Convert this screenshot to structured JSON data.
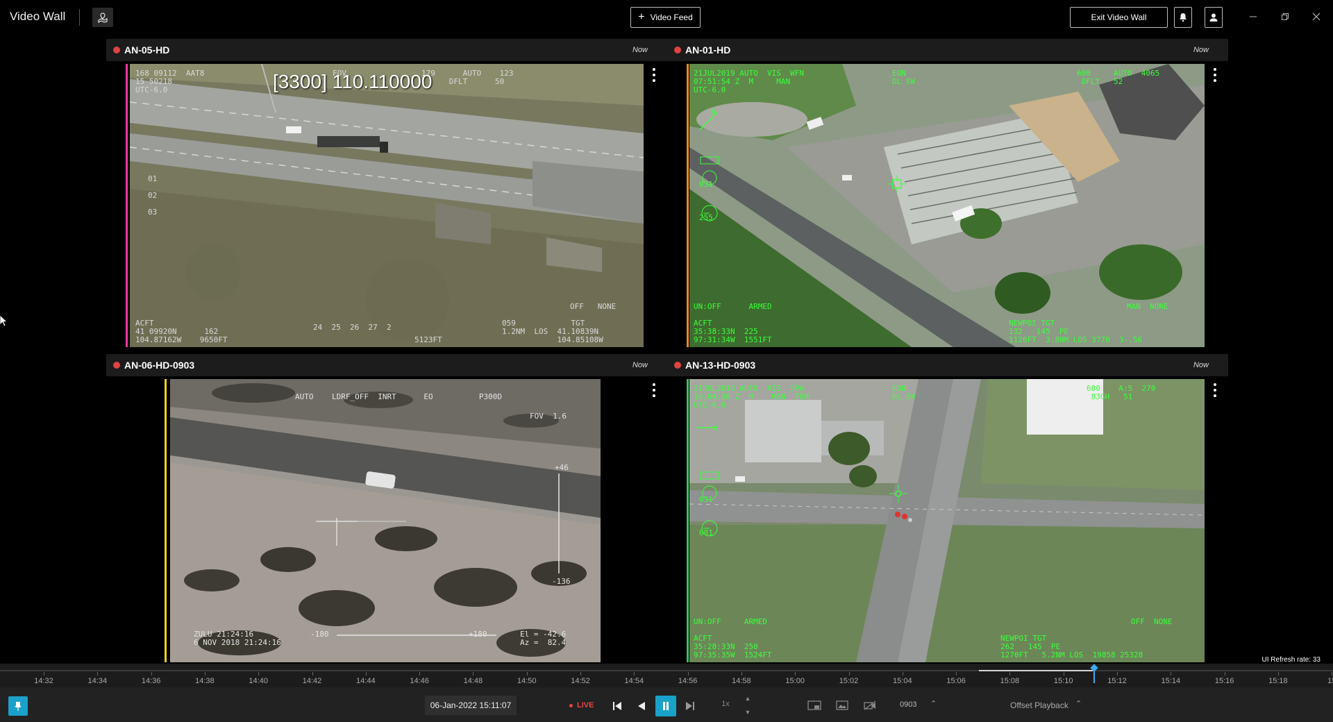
{
  "app": {
    "title": "Video Wall",
    "add_feed_label": "Video Feed",
    "exit_label": "Exit Video Wall"
  },
  "tiles": [
    {
      "name": "AN-05-HD",
      "time": "Now",
      "accent": "#e83aa0",
      "overlay_big": "[3300] 110.110000",
      "hud_color": "#d9d9d9",
      "hud": {
        "tl": "168 09112  AAT8\n15 50218\nUTC-6.0",
        "fov": "FOV",
        "tr1": "179      AUTO    123\n      DFLT      50",
        "scale": "01\n\n02\n\n03",
        "br_mode": "OFF   NONE",
        "bl": "ACFT\n41 09920N      162\n104.87162W    9650FT",
        "bottom_mid": "24  25  26  27  2",
        "b_range": "5123FT",
        "br": "059            TGT\n1.2NM  LOS  41.10839N\n            104.85108W"
      }
    },
    {
      "name": "AN-01-HD",
      "time": "Now",
      "accent": "#f08a24",
      "hud_color": "#3cff3c",
      "hud": {
        "tl": "21JUL2019 AUTO  VIS  WFN\n07:51:54 Z  M     MAN\nUTC-6.0",
        "tl_mode": "EON\nDL SW",
        "tr": "600     AUTO  4065\n DFLT   52",
        "left_nums": "031\n\n\n\n255",
        "b_left": "UN:OFF      ARMED",
        "br_mode": "MAN  NONE",
        "bl": "ACFT\n35:38:33N  225\n97:31:34W  1551FT",
        "br": "NEWPOI TGT\n132   145  PE\n1126FT  3.8NM LOS 3770  3-.56"
      }
    },
    {
      "name": "AN-06-HD-0903",
      "time": "Now",
      "accent": "#f2d21f",
      "hud_color": "#e5e5e5",
      "hud": {
        "top": "AUTO    LDRF_OFF  INRT      EO          P300D",
        "fov": "FOV  1.6",
        "scale_top": "+46",
        "scale_bottom": "-136",
        "zulu": "ZULU 21:24:16\n6 NOV 2018 21:24:16",
        "az_left": "-180",
        "az_right": "+180",
        "el": "El = -42.6\nAz =  82.4"
      }
    },
    {
      "name": "AN-13-HD-0903",
      "time": "Now",
      "accent": "#3fc061",
      "hud_color": "#3cff3c",
      "hud": {
        "tl": "21JUL2019 AUTO  VIS  SPA\n18:04:38 Z  M    MAN  TEM\nUTC-6.0",
        "tl_mode": "EON\nDL SW",
        "tr": "600    A:5  270\n 83GH   51",
        "left_nums": "031\n\n\n\n081",
        "b_left": "UN:OFF     ARMED",
        "br_mode": "OFF  NONE",
        "bl": "ACFT\n35:28:33N  250\n97:35:35W  1524FT",
        "br": "NEWPOI TGT\n262   145  PE\n1270FT   5.2NM LOS  19858 25328"
      }
    }
  ],
  "timeline": {
    "labels": [
      "14:32",
      "14:34",
      "14:36",
      "14:38",
      "14:40",
      "14:42",
      "14:44",
      "14:46",
      "14:48",
      "14:50",
      "14:52",
      "14:54",
      "14:56",
      "14:58",
      "15:00",
      "15:02",
      "15:04",
      "15:06",
      "15:08",
      "15:10",
      "15:12",
      "15:14",
      "15:16",
      "15:18",
      "15"
    ],
    "refresh_label": "UI Refresh rate: 33",
    "cursor_time": "15:11"
  },
  "controls": {
    "date": "06-Jan-2022 15:11:07",
    "live_label": "LIVE",
    "speed": "1x",
    "feed_id": "0903",
    "offset_label": "Offset Playback"
  }
}
